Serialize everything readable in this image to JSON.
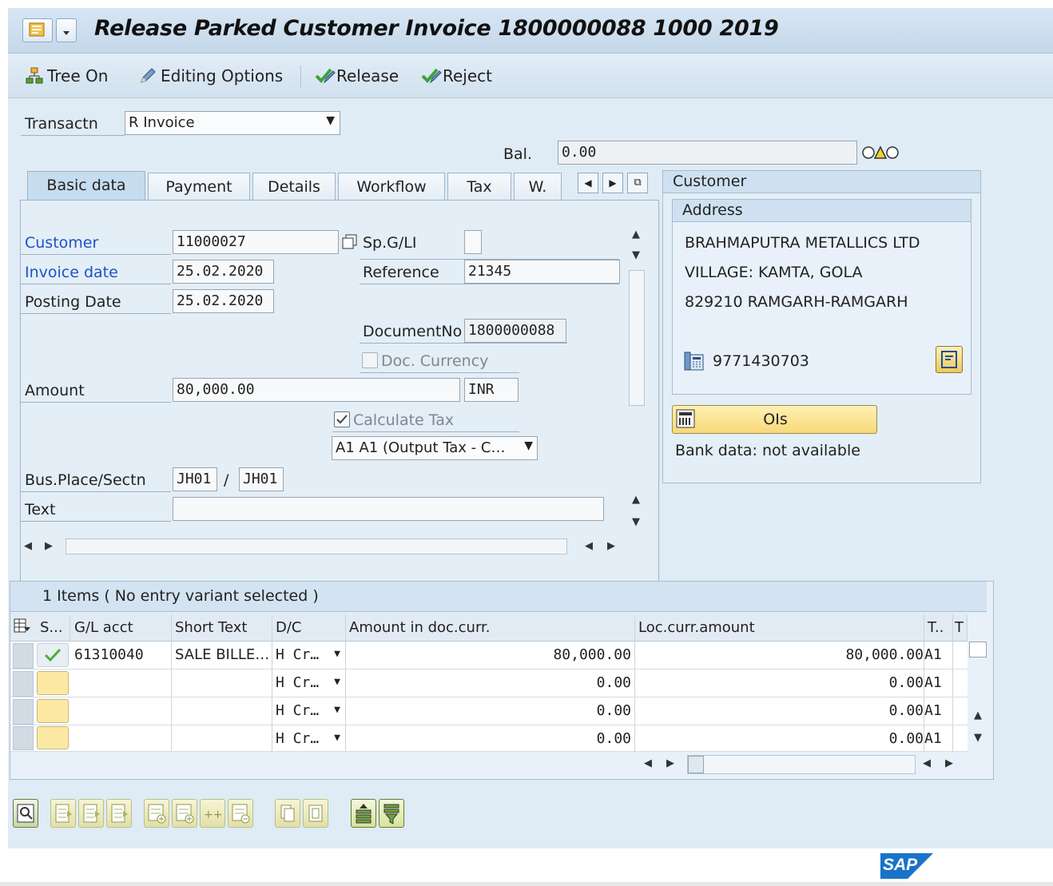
{
  "window": {
    "title": "Release Parked Customer Invoice 1800000088 1000 2019"
  },
  "toolbar": {
    "tree_on": "Tree On",
    "editing_options": "Editing Options",
    "release": "Release",
    "reject": "Reject"
  },
  "header": {
    "transactn_label": "Transactn",
    "transactn_value": "R Invoice",
    "bal_label": "Bal.",
    "bal_value": "0.00"
  },
  "tabs": [
    {
      "label": "Basic data",
      "active": true
    },
    {
      "label": "Payment"
    },
    {
      "label": "Details"
    },
    {
      "label": "Workflow"
    },
    {
      "label": "Tax"
    },
    {
      "label": "W."
    }
  ],
  "basic": {
    "customer_label": "Customer",
    "customer_value": "11000027",
    "spgl_label": "Sp.G/LI",
    "invoice_date_label": "Invoice date",
    "invoice_date_value": "25.02.2020",
    "reference_label": "Reference",
    "reference_value": "21345",
    "posting_date_label": "Posting Date",
    "posting_date_value": "25.02.2020",
    "documentno_label": "DocumentNo",
    "documentno_value": "1800000088",
    "doc_currency_label": "Doc. Currency",
    "amount_label": "Amount",
    "amount_value": "80,000.00",
    "currency_value": "INR",
    "calculate_tax_label": "Calculate Tax",
    "tax_code_value": "A1 A1 (Output Tax - C…",
    "bus_place_label": "Bus.Place/Sectn",
    "bus_place_value": "JH01",
    "slash": "/",
    "section_value": "JH01",
    "text_label": "Text",
    "text_value": ""
  },
  "customer_panel": {
    "title": "Customer",
    "address_title": "Address",
    "line1": "BRAHMAPUTRA METALLICS LTD",
    "line2": "VILLAGE: KAMTA, GOLA",
    "line3": "829210 RAMGARH-RAMGARH",
    "phone": "9771430703",
    "ois_button": "OIs",
    "bank_data": "Bank data: not available"
  },
  "items": {
    "title": "1 Items ( No entry variant selected )",
    "columns": [
      "S...",
      "G/L acct",
      "Short Text",
      "D/C",
      "Amount in doc.curr.",
      "Loc.curr.amount",
      "T..",
      "T"
    ],
    "rows": [
      {
        "gl": "61310040",
        "short_text": "SALE BILLE…",
        "dc": "H Cr…",
        "amount": "80,000.00",
        "loc_amount": "80,000.00",
        "tax": "A1"
      },
      {
        "gl": "",
        "short_text": "",
        "dc": "H Cr…",
        "amount": "0.00",
        "loc_amount": "0.00",
        "tax": "A1"
      },
      {
        "gl": "",
        "short_text": "",
        "dc": "H Cr…",
        "amount": "0.00",
        "loc_amount": "0.00",
        "tax": "A1"
      },
      {
        "gl": "",
        "short_text": "",
        "dc": "H Cr…",
        "amount": "0.00",
        "loc_amount": "0.00",
        "tax": "A1"
      }
    ]
  },
  "footer": {
    "logo": "SAP"
  },
  "colors": {
    "background": "#dfebf5",
    "required_label": "#1f52c7",
    "ois_button": "#fbe39a",
    "sap_logo": "#1a73c8"
  }
}
